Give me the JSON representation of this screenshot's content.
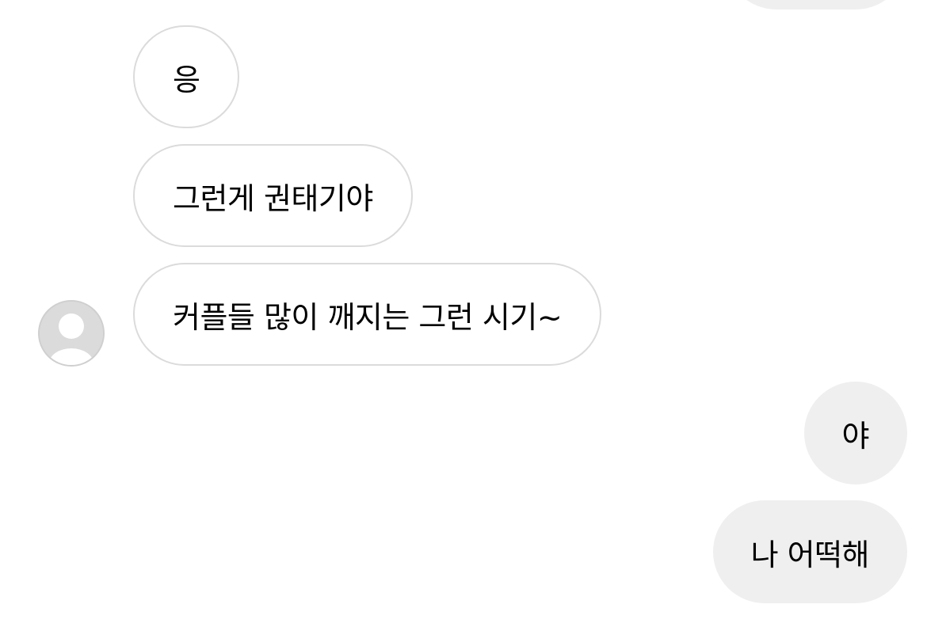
{
  "conversation": {
    "incoming": [
      {
        "text": "응"
      },
      {
        "text": "그런게 권태기야"
      },
      {
        "text": "커플들 많이 깨지는 그런 시기~"
      }
    ],
    "outgoing": [
      {
        "text": "야"
      },
      {
        "text": "나 어떡해"
      }
    ]
  },
  "colors": {
    "incoming_bubble_border": "#dbdbdb",
    "outgoing_bubble_bg": "#efefef",
    "avatar_placeholder": "#dbdbdb"
  },
  "icons": {
    "sender_avatar": "default-profile-avatar-icon"
  }
}
